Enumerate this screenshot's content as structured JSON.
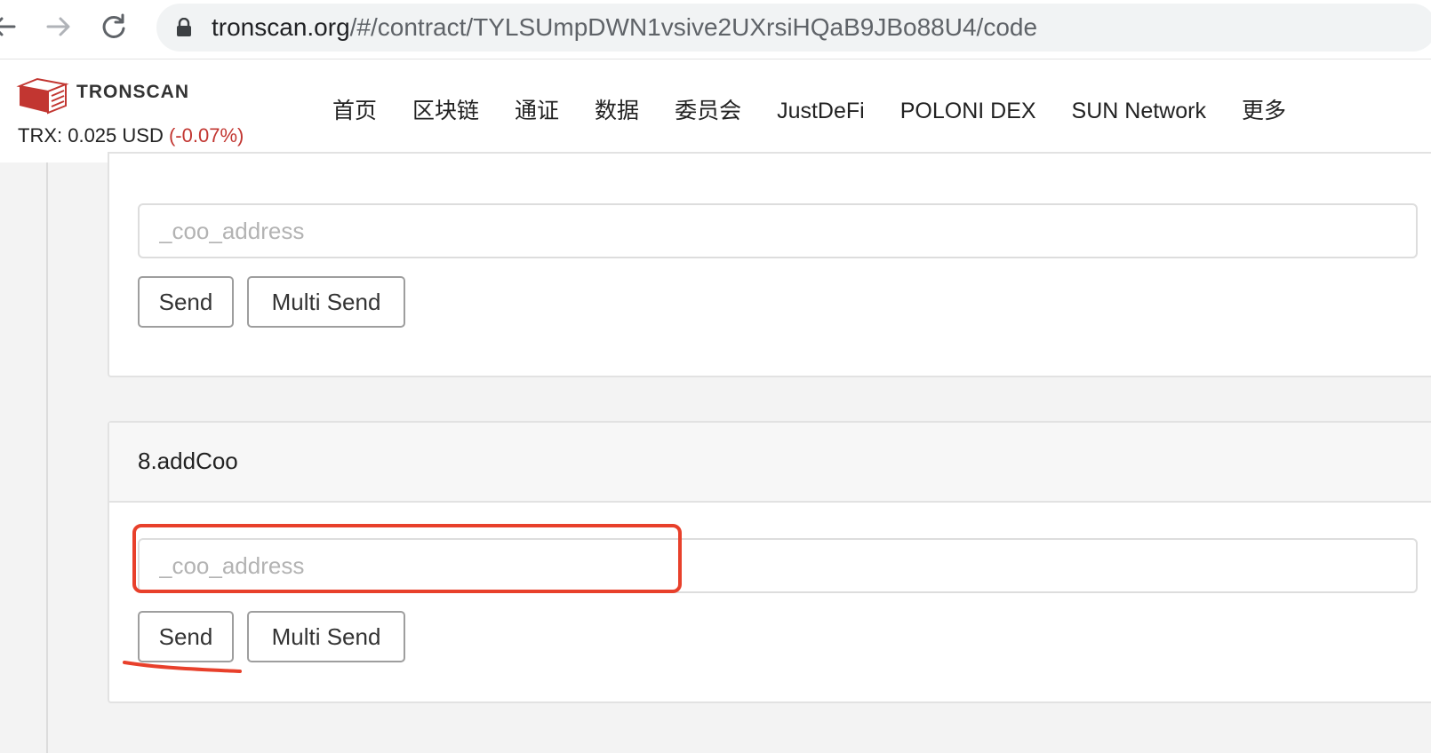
{
  "browser": {
    "url_host": "tronscan.org",
    "url_path": "/#/contract/TYLSUmpDWN1vsive2UXrsiHQaB9JBo88U4/code",
    "icons": [
      "back-icon",
      "forward-icon",
      "reload-icon",
      "lock-icon"
    ]
  },
  "header": {
    "brand": "TRONSCAN",
    "price_label": "TRX: 0.025 USD",
    "price_change": "(-0.07%)",
    "nav": [
      "首页",
      "区块链",
      "通证",
      "数据",
      "委员会",
      "JustDeFi",
      "POLONI DEX",
      "SUN Network",
      "更多"
    ]
  },
  "cards": [
    {
      "title": "",
      "input_placeholder": "_coo_address",
      "send_label": "Send",
      "multi_send_label": "Multi Send"
    },
    {
      "title": "8.addCoo",
      "input_placeholder": "_coo_address",
      "send_label": "Send",
      "multi_send_label": "Multi Send"
    }
  ],
  "colors": {
    "price_change": "#c23631",
    "annotation": "#e8402b",
    "logo": "#c23631"
  }
}
